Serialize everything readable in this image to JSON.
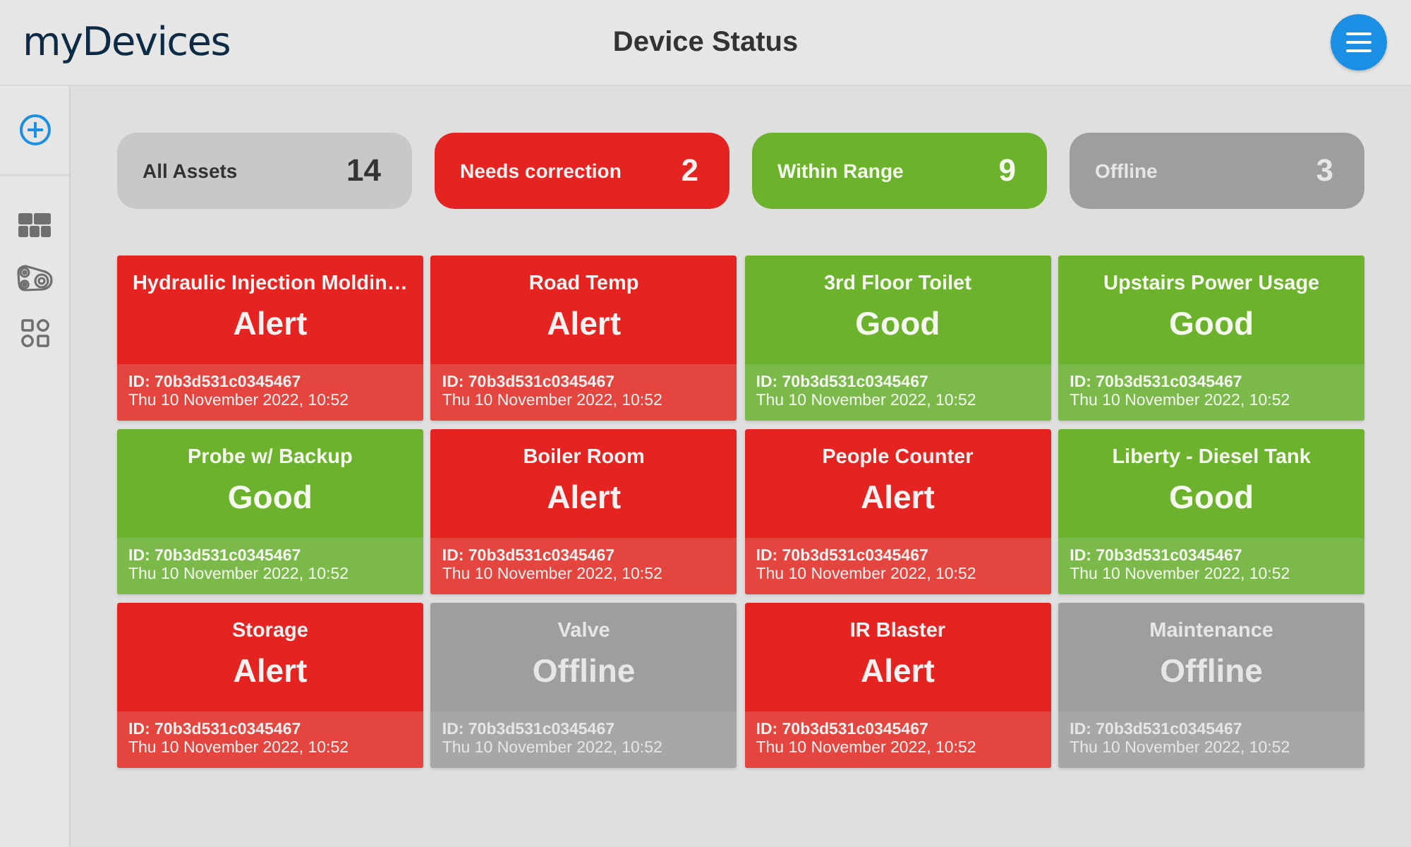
{
  "header": {
    "logo": "myDevices",
    "title": "Device Status"
  },
  "summary": [
    {
      "kind": "all",
      "label": "All Assets",
      "count": "14"
    },
    {
      "kind": "alert",
      "label": "Needs correction",
      "count": "2"
    },
    {
      "kind": "good",
      "label": "Within Range",
      "count": "9"
    },
    {
      "kind": "offline",
      "label": "Offline",
      "count": "3"
    }
  ],
  "devices": [
    {
      "kind": "alert",
      "name": "Hydraulic Injection Moldin…",
      "status": "Alert",
      "id": "ID: 70b3d531c0345467",
      "timestamp": "Thu 10 November 2022, 10:52"
    },
    {
      "kind": "alert",
      "name": "Road Temp",
      "status": "Alert",
      "id": "ID: 70b3d531c0345467",
      "timestamp": "Thu 10 November 2022, 10:52"
    },
    {
      "kind": "good",
      "name": "3rd Floor Toilet",
      "status": "Good",
      "id": "ID: 70b3d531c0345467",
      "timestamp": "Thu 10 November 2022, 10:52"
    },
    {
      "kind": "good",
      "name": "Upstairs Power Usage",
      "status": "Good",
      "id": "ID: 70b3d531c0345467",
      "timestamp": "Thu 10 November 2022, 10:52"
    },
    {
      "kind": "good",
      "name": "Probe w/ Backup",
      "status": "Good",
      "id": "ID: 70b3d531c0345467",
      "timestamp": "Thu 10 November 2022, 10:52"
    },
    {
      "kind": "alert",
      "name": "Boiler Room",
      "status": "Alert",
      "id": "ID: 70b3d531c0345467",
      "timestamp": "Thu 10 November 2022, 10:52"
    },
    {
      "kind": "alert",
      "name": "People Counter",
      "status": "Alert",
      "id": "ID: 70b3d531c0345467",
      "timestamp": "Thu 10 November 2022, 10:52"
    },
    {
      "kind": "good",
      "name": "Liberty - Diesel Tank",
      "status": "Good",
      "id": "ID: 70b3d531c0345467",
      "timestamp": "Thu 10 November 2022, 10:52"
    },
    {
      "kind": "alert",
      "name": "Storage",
      "status": "Alert",
      "id": "ID: 70b3d531c0345467",
      "timestamp": "Thu 10 November 2022, 10:52"
    },
    {
      "kind": "offline",
      "name": "Valve",
      "status": "Offline",
      "id": "ID: 70b3d531c0345467",
      "timestamp": "Thu 10 November 2022, 10:52"
    },
    {
      "kind": "alert",
      "name": "IR Blaster",
      "status": "Alert",
      "id": "ID: 70b3d531c0345467",
      "timestamp": "Thu 10 November 2022, 10:52"
    },
    {
      "kind": "offline",
      "name": "Maintenance",
      "status": "Offline",
      "id": "ID: 70b3d531c0345467",
      "timestamp": "Thu 10 November 2022, 10:52"
    }
  ]
}
